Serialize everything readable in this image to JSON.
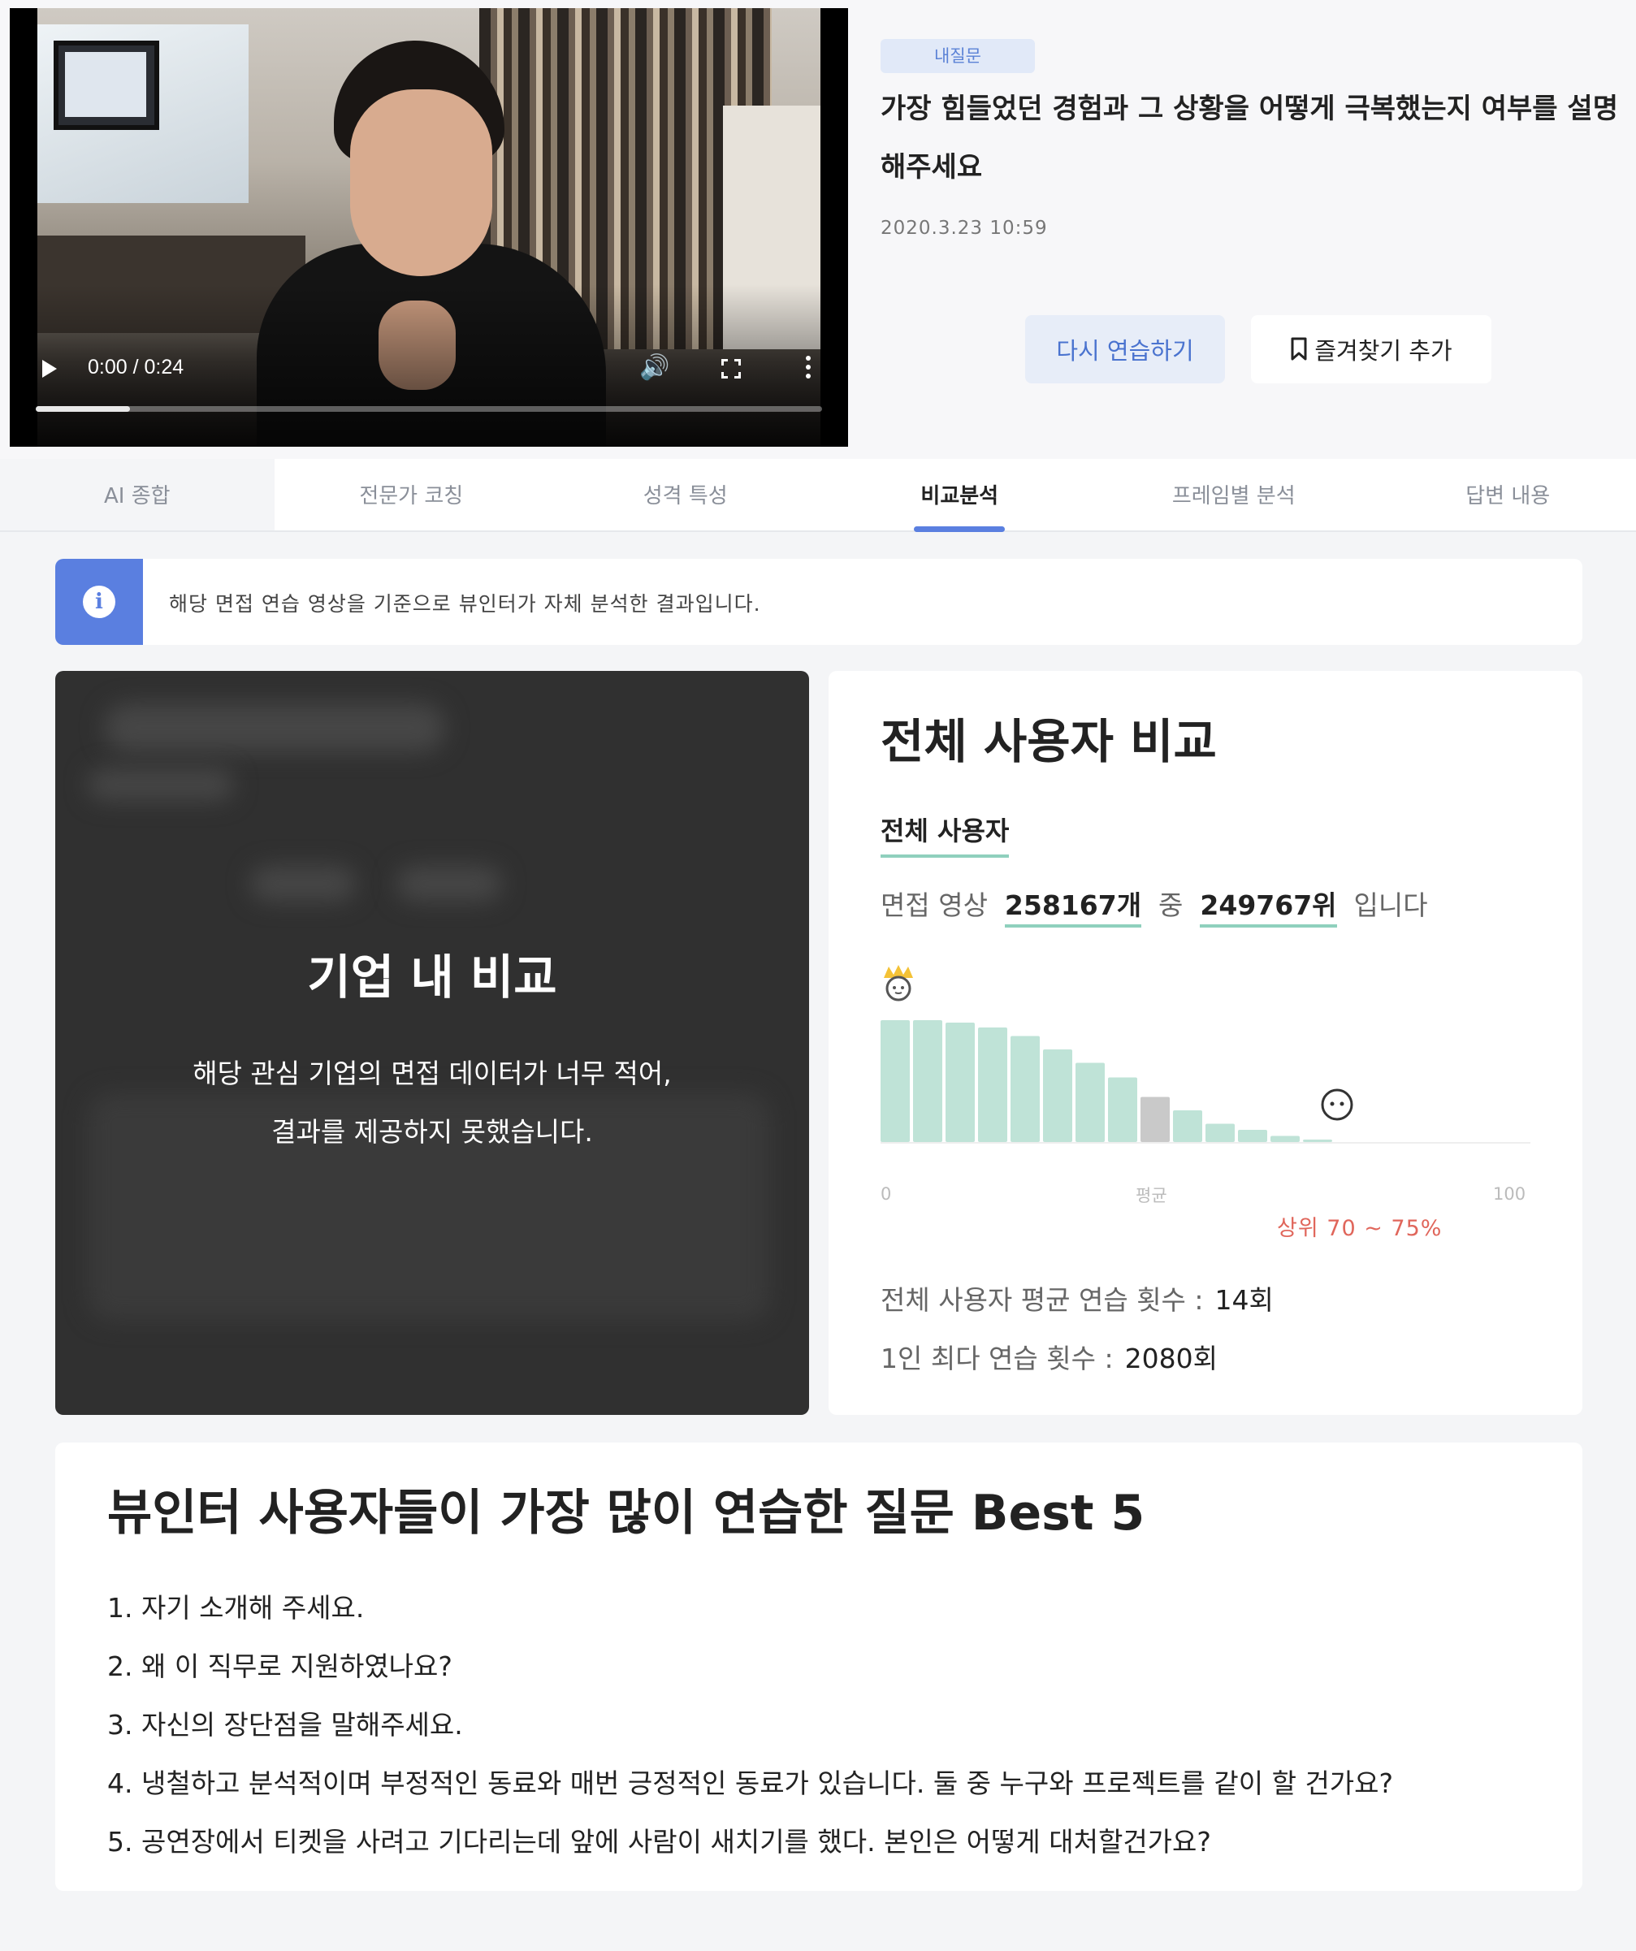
{
  "video": {
    "time": "0:00 / 0:24",
    "progress": 0.12
  },
  "question": {
    "badge": "내질문",
    "title": "가장 힘들었던 경험과 그 상황을 어떻게 극복했는지 여부를 설명해주세요",
    "date": "2020.3.23 10:59",
    "retry_label": "다시 연습하기",
    "favorite_label": "즐겨찾기 추가"
  },
  "tabs": [
    {
      "label": "AI 종합"
    },
    {
      "label": "전문가 코칭"
    },
    {
      "label": "성격 특성"
    },
    {
      "label": "비교분석"
    },
    {
      "label": "프레임별 분석"
    },
    {
      "label": "답변 내용"
    }
  ],
  "active_tab": 3,
  "info": {
    "text": "해당 면접 연습 영상을 기준으로 뷰인터가 자체 분석한 결과입니다."
  },
  "company": {
    "title": "기업 내 비교",
    "line1": "해당 관심 기업의 면접 데이터가 너무 적어,",
    "line2": "결과를 제공하지 못했습니다."
  },
  "compare": {
    "title": "전체 사용자 비교",
    "subtitle": "전체 사용자",
    "rank_prefix": "면접 영상",
    "total": "258167개",
    "middle": "중",
    "rank": "249767위",
    "suffix": "입니다",
    "axis_min": "0",
    "axis_avg": "평균",
    "axis_max": "100",
    "range_label": "상위 70 ~ 75%",
    "avg_label": "전체 사용자 평균 연습 횟수 :",
    "avg_value": "14회",
    "max_label": "1인 최다 연습 횟수 :",
    "max_value": "2080회"
  },
  "chart_data": {
    "type": "bar",
    "values": [
      100,
      100,
      98,
      94,
      87,
      76,
      65,
      53,
      37,
      26,
      15,
      10,
      5,
      2
    ],
    "highlight_index": 8,
    "user_index": 14,
    "xlim": [
      0,
      100
    ],
    "colors": {
      "bar": "#bfe3d7",
      "highlight": "#c9c9c9"
    }
  },
  "best5": {
    "title": "뷰인터 사용자들이 가장 많이 연습한 질문 Best 5",
    "items": [
      "1. 자기 소개해 주세요.",
      "2. 왜 이 직무로 지원하였나요?",
      "3. 자신의 장단점을 말해주세요.",
      "4. 냉철하고 분석적이며 부정적인 동료와 매번 긍정적인 동료가 있습니다. 둘 중 누구와 프로젝트를 같이 할 건가요?",
      "5. 공연장에서 티켓을 사려고 기다리는데 앞에 사람이 새치기를 했다. 본인은 어떻게 대처할건가요?"
    ]
  }
}
